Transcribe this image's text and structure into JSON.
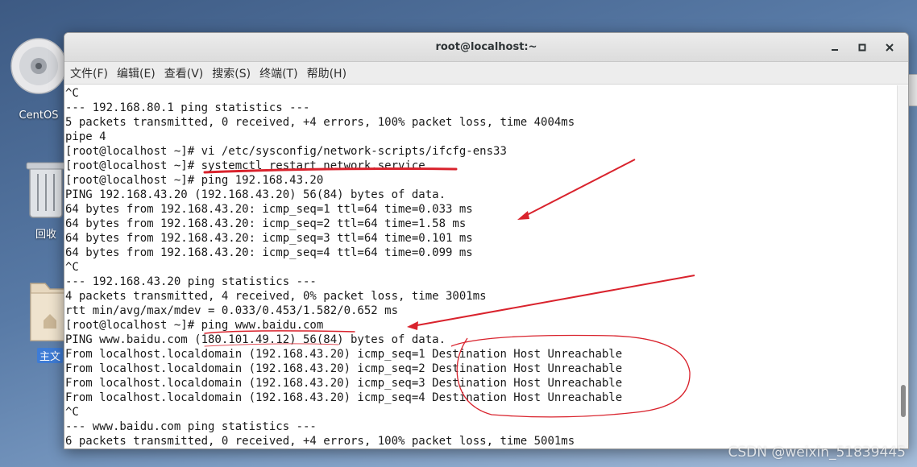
{
  "window": {
    "title": "root@localhost:~"
  },
  "menu": [
    {
      "label": "文件(F)"
    },
    {
      "label": "编辑(E)"
    },
    {
      "label": "查看(V)"
    },
    {
      "label": "搜索(S)"
    },
    {
      "label": "终端(T)"
    },
    {
      "label": "帮助(H)"
    }
  ],
  "desktop": {
    "icons": [
      {
        "label": "CentOS",
        "icon": "disc-icon"
      },
      {
        "label": "回收",
        "icon": "trash-icon"
      },
      {
        "label": "主文",
        "icon": "home-folder-icon"
      }
    ]
  },
  "terminal": {
    "lines": [
      "^C",
      "--- 192.168.80.1 ping statistics ---",
      "5 packets transmitted, 0 received, +4 errors, 100% packet loss, time 4004ms",
      "pipe 4",
      "[root@localhost ~]# vi /etc/sysconfig/network-scripts/ifcfg-ens33",
      "[root@localhost ~]# systemctl restart network.service",
      "[root@localhost ~]# ping 192.168.43.20",
      "PING 192.168.43.20 (192.168.43.20) 56(84) bytes of data.",
      "64 bytes from 192.168.43.20: icmp_seq=1 ttl=64 time=0.033 ms",
      "64 bytes from 192.168.43.20: icmp_seq=2 ttl=64 time=1.58 ms",
      "64 bytes from 192.168.43.20: icmp_seq=3 ttl=64 time=0.101 ms",
      "64 bytes from 192.168.43.20: icmp_seq=4 ttl=64 time=0.099 ms",
      "^C",
      "--- 192.168.43.20 ping statistics ---",
      "4 packets transmitted, 4 received, 0% packet loss, time 3001ms",
      "rtt min/avg/max/mdev = 0.033/0.453/1.582/0.652 ms",
      "[root@localhost ~]# ping www.baidu.com",
      "PING www.baidu.com (180.101.49.12) 56(84) bytes of data.",
      "From localhost.localdomain (192.168.43.20) icmp_seq=1 Destination Host Unreachable",
      "From localhost.localdomain (192.168.43.20) icmp_seq=2 Destination Host Unreachable",
      "From localhost.localdomain (192.168.43.20) icmp_seq=3 Destination Host Unreachable",
      "From localhost.localdomain (192.168.43.20) icmp_seq=4 Destination Host Unreachable",
      "^C",
      "--- www.baidu.com ping statistics ---",
      "6 packets transmitted, 0 received, +4 errors, 100% packet loss, time 5001ms"
    ]
  },
  "watermark": "CSDN @weixin_51839445",
  "colors": {
    "annotation": "#d9232d",
    "terminal_bg": "#ffffff",
    "terminal_fg": "#1a1a1a"
  }
}
